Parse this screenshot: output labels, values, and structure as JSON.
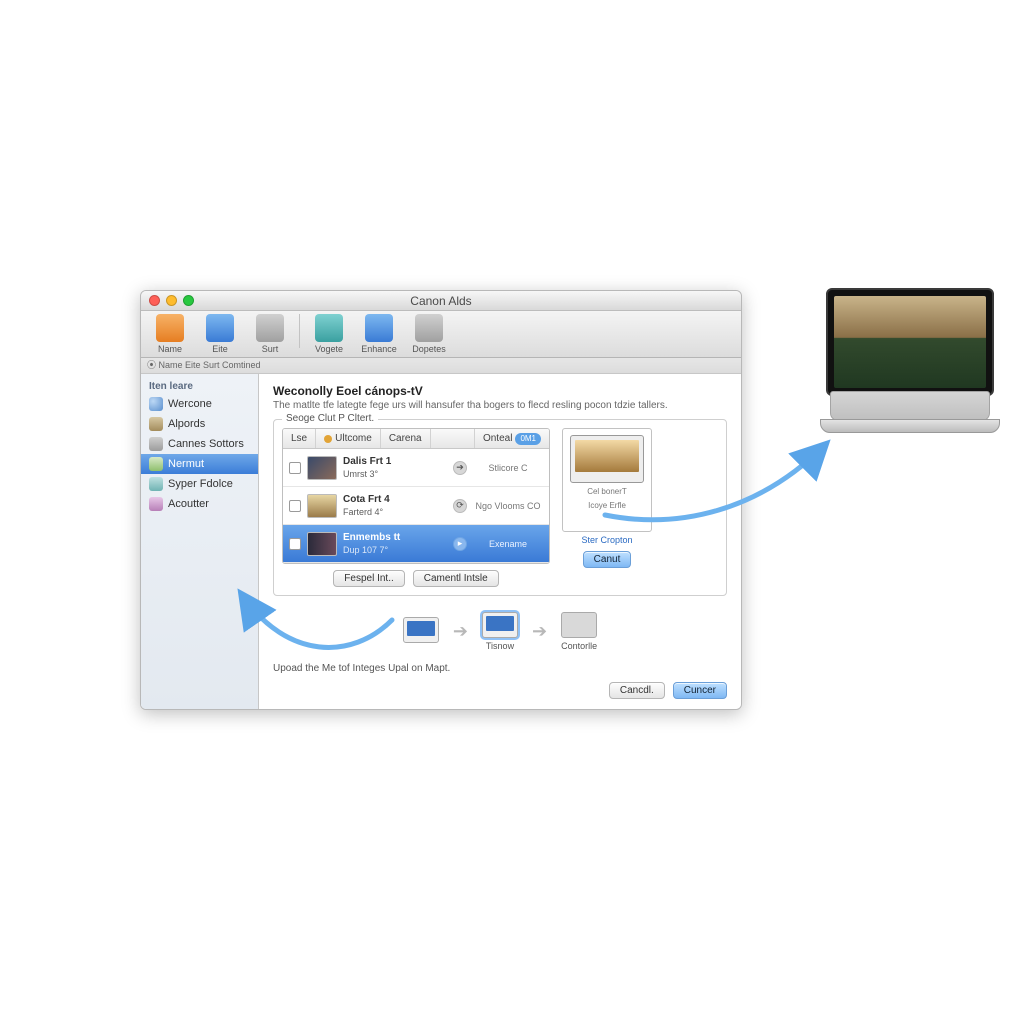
{
  "window": {
    "title": "Canon Alds"
  },
  "toolbar": {
    "status_strip": "⦿ Name  Eite Surt Comtined",
    "items": [
      {
        "label": "Name"
      },
      {
        "label": "Eite"
      },
      {
        "label": "Surt"
      },
      {
        "label": "Vogete"
      },
      {
        "label": "Enhance"
      },
      {
        "label": "Dopetes"
      }
    ]
  },
  "sidebar": {
    "heading": "Iten leare",
    "items": [
      {
        "label": "Wercone"
      },
      {
        "label": "Alpords"
      },
      {
        "label": "Cannes Sottors"
      },
      {
        "label": "Nermut",
        "selected": true
      },
      {
        "label": "Syper Fdolce"
      },
      {
        "label": "Acoutter"
      }
    ]
  },
  "content": {
    "heading": "Weconolly Eoel cánops-tV",
    "description": "The matlte tfe lategte fege urs will hansufer tha bogers to flecd resling pocon tdzie tallers.",
    "group_legend": "Seoge Clut P Cltert.",
    "tabs": [
      {
        "label": "Lse"
      },
      {
        "label": "Ultcome"
      },
      {
        "label": "Carena"
      },
      {
        "label": "Onteal",
        "pill": "0M1"
      }
    ],
    "rows": [
      {
        "title": "Dalis Frt 1",
        "sub": "Umrst 3°",
        "status": "Stlicore C"
      },
      {
        "title": "Cota Frt 4",
        "sub": "Farterd 4°",
        "status": "Ngo Vlooms CO"
      },
      {
        "title": "Enmembs tt",
        "sub": "Dup 107 7°",
        "status": "Exename",
        "selected": true
      }
    ],
    "list_buttons": {
      "left": "Fespel Int..",
      "right": "Camentl Intsle"
    },
    "preview": {
      "caption1": "Cel bonerT",
      "caption2": "Icoye Erfle",
      "link": "Ster Cropton",
      "button": "Canut"
    },
    "flow": {
      "device1": "",
      "device2": "Tisnow",
      "device3": "Contorlle"
    },
    "footnote": "Upoad the Me tof Integes Upal on Mapt.",
    "footer": {
      "cancel": "Cancdl.",
      "confirm": "Cuncer"
    }
  }
}
